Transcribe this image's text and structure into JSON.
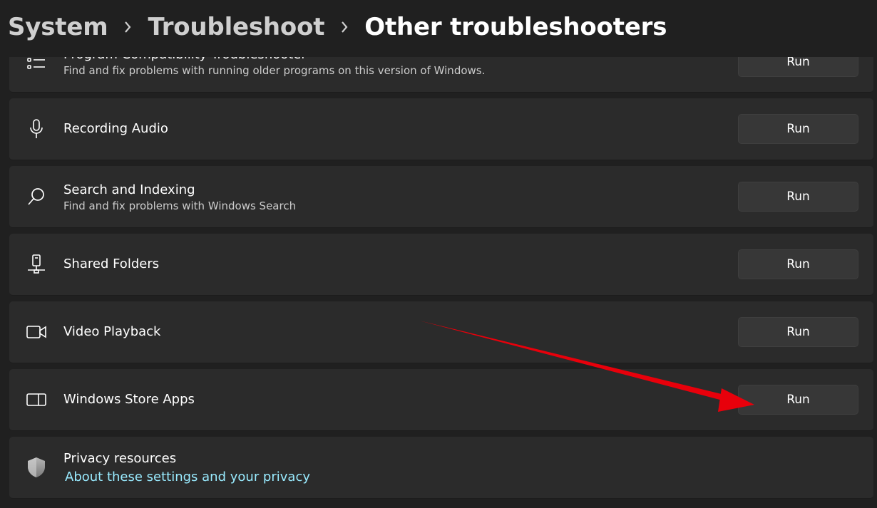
{
  "breadcrumb": {
    "level1": "System",
    "level2": "Troubleshoot",
    "current": "Other troubleshooters"
  },
  "troubleshooters": [
    {
      "title": "Program Compatibility Troubleshooter",
      "description": "Find and fix problems with running older programs on this version of Windows.",
      "button": "Run",
      "icon": "list-icon"
    },
    {
      "title": "Recording Audio",
      "description": "",
      "button": "Run",
      "icon": "microphone-icon"
    },
    {
      "title": "Search and Indexing",
      "description": "Find and fix problems with Windows Search",
      "button": "Run",
      "icon": "search-icon"
    },
    {
      "title": "Shared Folders",
      "description": "",
      "button": "Run",
      "icon": "network-drive-icon"
    },
    {
      "title": "Video Playback",
      "description": "",
      "button": "Run",
      "icon": "video-camera-icon"
    },
    {
      "title": "Windows Store Apps",
      "description": "",
      "button": "Run",
      "icon": "store-app-icon"
    }
  ],
  "privacy": {
    "title": "Privacy resources",
    "link": "About these settings and your privacy",
    "icon": "shield-icon"
  },
  "colors": {
    "background": "#202020",
    "card": "#2b2b2b",
    "button": "#373737",
    "link": "#99ebff",
    "annotation_arrow": "#e8000b"
  }
}
